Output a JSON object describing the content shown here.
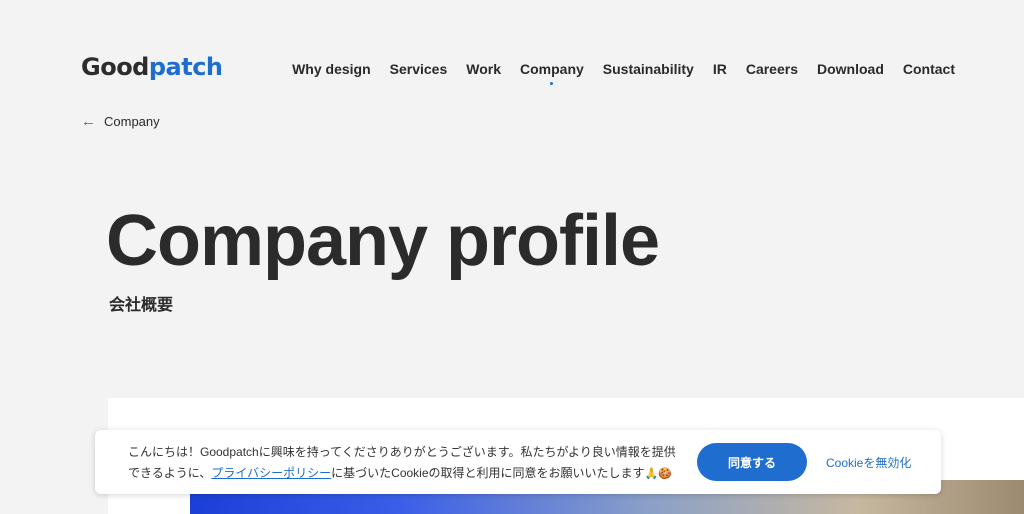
{
  "header": {
    "logo_part1": "Good",
    "logo_part2": "patch",
    "nav": [
      {
        "label": "Why design"
      },
      {
        "label": "Services"
      },
      {
        "label": "Work"
      },
      {
        "label": "Company",
        "active": true
      },
      {
        "label": "Sustainability"
      },
      {
        "label": "IR"
      },
      {
        "label": "Careers"
      },
      {
        "label": "Download"
      },
      {
        "label": "Contact"
      }
    ]
  },
  "breadcrumb": {
    "icon": "arrow-left-icon",
    "label": "Company"
  },
  "hero": {
    "title": "Company profile",
    "subtitle": "会社概要"
  },
  "cookie_banner": {
    "text_before": "こんにちは！Goodpatchに興味を持ってくださりありがとうございます。私たちがより良い情報を提供できるように、",
    "policy_link": "プライバシーポリシー",
    "text_after": "に基づいたCookieの取得と利用に同意をお願いいたします",
    "emoji": "🙏🍪",
    "agree_label": "同意する",
    "disable_label": "Cookieを無効化"
  },
  "colors": {
    "accent": "#1f6ecf",
    "background": "#f3f3f3",
    "text": "#2b2b2b"
  }
}
